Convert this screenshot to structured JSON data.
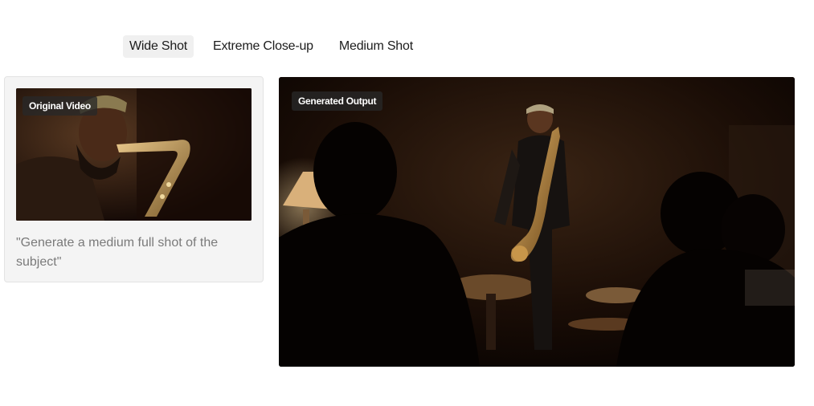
{
  "tabs": [
    {
      "label": "Wide Shot",
      "active": true
    },
    {
      "label": "Extreme Close-up",
      "active": false
    },
    {
      "label": "Medium Shot",
      "active": false
    }
  ],
  "source_card": {
    "badge": "Original Video",
    "prompt": "\"Generate a medium full shot of the subject\""
  },
  "output_panel": {
    "badge": "Generated Output"
  },
  "colors": {
    "tab_active_bg": "#f0f0f0",
    "card_bg": "#f4f4f4",
    "prompt_text": "#7a7a7a",
    "badge_bg": "#282828"
  }
}
